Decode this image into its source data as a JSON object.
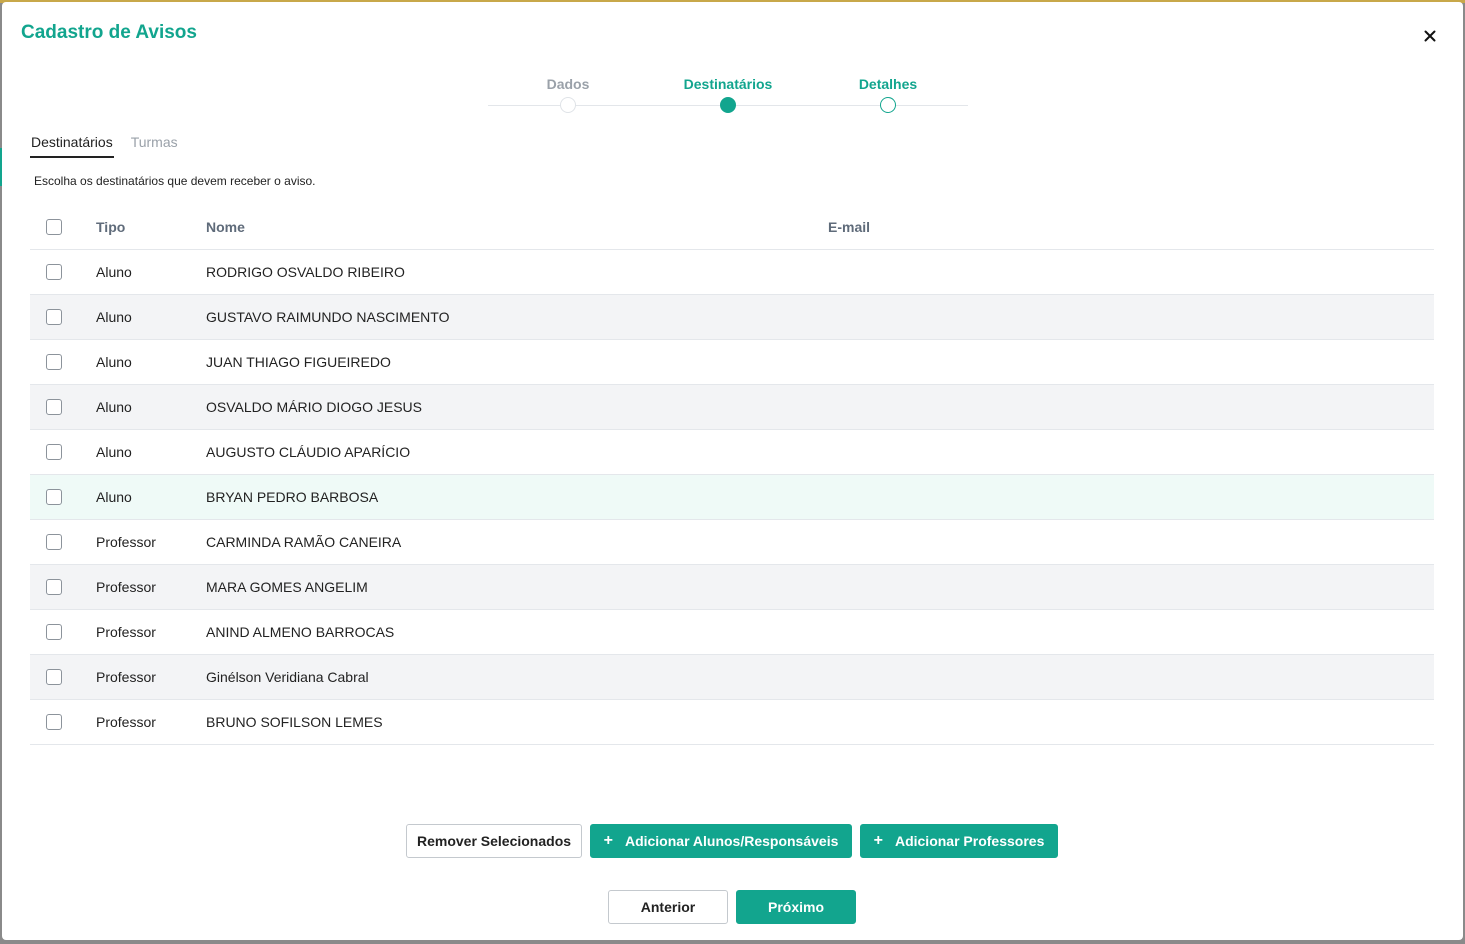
{
  "modal": {
    "title": "Cadastro de Avisos"
  },
  "stepper": {
    "steps": [
      {
        "label": "Dados",
        "state": "done"
      },
      {
        "label": "Destinatários",
        "state": "active"
      },
      {
        "label": "Detalhes",
        "state": "todo"
      }
    ]
  },
  "tabs": [
    {
      "label": "Destinatários",
      "active": true
    },
    {
      "label": "Turmas",
      "active": false
    }
  ],
  "instructions": "Escolha os destinatários que devem receber o aviso.",
  "table": {
    "headers": {
      "tipo": "Tipo",
      "nome": "Nome",
      "email": "E-mail"
    },
    "rows": [
      {
        "tipo": "Aluno",
        "nome": "RODRIGO OSVALDO RIBEIRO",
        "email": ""
      },
      {
        "tipo": "Aluno",
        "nome": "GUSTAVO RAIMUNDO NASCIMENTO",
        "email": ""
      },
      {
        "tipo": "Aluno",
        "nome": "JUAN THIAGO FIGUEIREDO",
        "email": ""
      },
      {
        "tipo": "Aluno",
        "nome": "OSVALDO MÁRIO DIOGO JESUS",
        "email": ""
      },
      {
        "tipo": "Aluno",
        "nome": "AUGUSTO CLÁUDIO APARÍCIO",
        "email": ""
      },
      {
        "tipo": "Aluno",
        "nome": "BRYAN PEDRO BARBOSA",
        "email": ""
      },
      {
        "tipo": "Professor",
        "nome": "CARMINDA RAMÃO CANEIRA",
        "email": ""
      },
      {
        "tipo": "Professor",
        "nome": "MARA GOMES ANGELIM",
        "email": ""
      },
      {
        "tipo": "Professor",
        "nome": "ANIND ALMENO BARROCAS",
        "email": ""
      },
      {
        "tipo": "Professor",
        "nome": "Ginélson Veridiana Cabral",
        "email": ""
      },
      {
        "tipo": "Professor",
        "nome": "BRUNO SOFILSON LEMES",
        "email": ""
      }
    ]
  },
  "actions": {
    "remove_label": "Remover Selecionados",
    "add_students_label": "Adicionar Alunos/Responsáveis",
    "add_teachers_label": "Adicionar Professores",
    "plus_glyph": "+"
  },
  "navigation": {
    "previous_label": "Anterior",
    "next_label": "Próximo"
  },
  "colors": {
    "accent": "#12a58e",
    "top_border": "#c8a84a"
  }
}
